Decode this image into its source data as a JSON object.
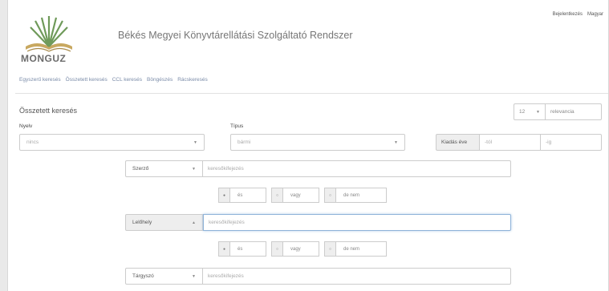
{
  "header": {
    "title": "Békés Megyei Könyvtárellátási Szolgáltató Rendszer",
    "logo_text": "MONGUZ",
    "top_links": [
      "Bejelentkezés",
      "Magyar"
    ]
  },
  "menu": [
    "Egyszerű keresés",
    "Összetett keresés",
    "CCL keresés",
    "Böngészés",
    "Rácskeresés"
  ],
  "search": {
    "title": "Összetett keresés",
    "page_size": "12",
    "sort": "relevancia",
    "language": {
      "label": "Nyelv",
      "value": "nincs"
    },
    "type": {
      "label": "Típus",
      "value": "bármi"
    },
    "year": {
      "label": "Kiadás éve",
      "from": "-tól",
      "to": "-ig"
    },
    "rows": [
      {
        "field": "Szerző",
        "placeholder": "keresőkifejezés"
      },
      {
        "field": "Lelőhely",
        "placeholder": "keresőkifejezés"
      },
      {
        "field": "Tárgyszó",
        "placeholder": "keresőkifejezés"
      }
    ],
    "operators": [
      "és",
      "vagy",
      "de nem"
    ]
  }
}
